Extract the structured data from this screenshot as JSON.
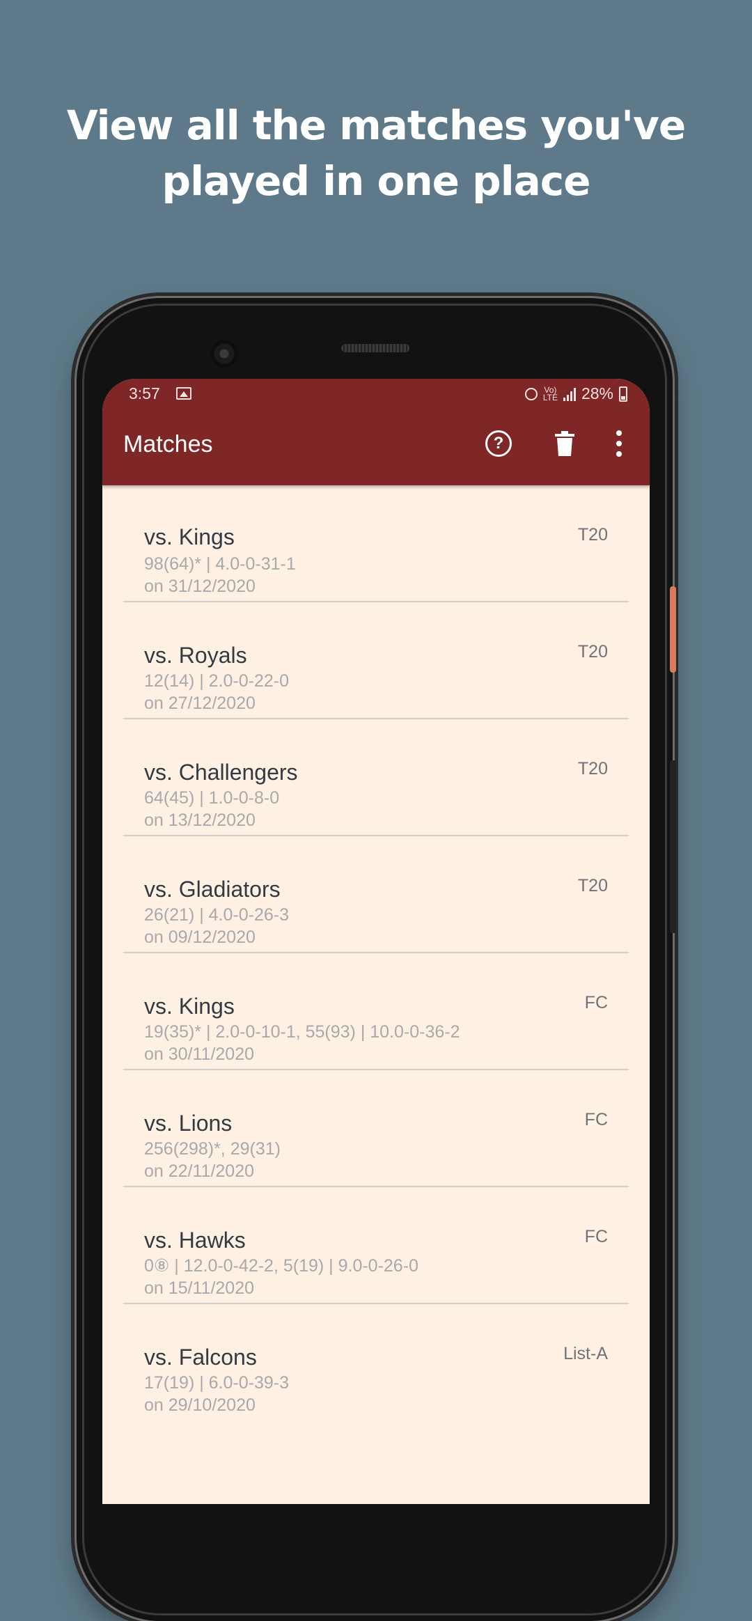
{
  "headline": {
    "line1": "View all the matches you've",
    "line2": "played in one place"
  },
  "status_bar": {
    "time": "3:57",
    "network": "Vo)\nLTE",
    "battery": "28%"
  },
  "app_bar": {
    "title": "Matches",
    "icons": [
      "help-icon",
      "delete-icon",
      "more-vert-icon"
    ]
  },
  "colors": {
    "background": "#5e7a8a",
    "app_bar": "#7f2726",
    "list_background": "#fff0e4"
  },
  "matches": [
    {
      "title": "vs. Kings",
      "stats": "98(64)* | 4.0-0-31-1",
      "date": "on 31/12/2020",
      "format": "T20"
    },
    {
      "title": "vs. Royals",
      "stats": "12(14) | 2.0-0-22-0",
      "date": "on 27/12/2020",
      "format": "T20"
    },
    {
      "title": "vs. Challengers",
      "stats": "64(45) | 1.0-0-8-0",
      "date": "on 13/12/2020",
      "format": "T20"
    },
    {
      "title": "vs. Gladiators",
      "stats": "26(21) | 4.0-0-26-3",
      "date": "on 09/12/2020",
      "format": "T20"
    },
    {
      "title": "vs. Kings",
      "stats": "19(35)* | 2.0-0-10-1, 55(93) | 10.0-0-36-2",
      "date": "on 30/11/2020",
      "format": "FC"
    },
    {
      "title": "vs. Lions",
      "stats": "256(298)*, 29(31)",
      "date": "on 22/11/2020",
      "format": "FC"
    },
    {
      "title": "vs. Hawks",
      "stats": "0⑧ | 12.0-0-42-2, 5(19) | 9.0-0-26-0",
      "date": "on 15/11/2020",
      "format": "FC"
    },
    {
      "title": "vs. Falcons",
      "stats": "17(19) | 6.0-0-39-3",
      "date": "on 29/10/2020",
      "format": "List-A"
    }
  ]
}
